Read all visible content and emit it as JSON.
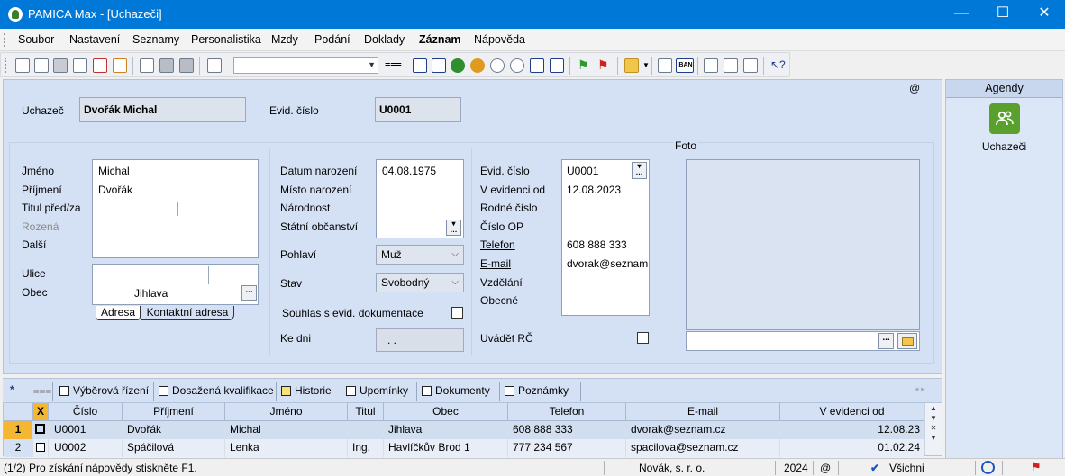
{
  "window": {
    "title": "PAMICA Max - [Uchazeči]",
    "controls": {
      "minimize": "—",
      "maximize": "☐",
      "close": "✕"
    }
  },
  "menu": [
    "Soubor",
    "Nastavení",
    "Seznamy",
    "Personalistika",
    "Mzdy",
    "Podání",
    "Doklady",
    "Záznam",
    "Nápověda"
  ],
  "toolbar": {
    "combo_value": ""
  },
  "header": {
    "at_symbol": "@",
    "uchazec_label": "Uchazeč",
    "uchazec_value": "Dvořák Michal",
    "evid_label": "Evid. číslo",
    "evid_value": "U0001"
  },
  "personal": {
    "jmeno_label": "Jméno",
    "prijmeni_label": "Příjmení",
    "titul_label": "Titul před/za",
    "rozena_label": "Rozená",
    "dalsi_label": "Další",
    "jmeno_value": "Michal",
    "prijmeni_value": "Dvořák"
  },
  "address": {
    "ulice_label": "Ulice",
    "obec_label": "Obec",
    "obec_value": "Jihlava",
    "tab_adresa": "Adresa",
    "tab_kontaktni": "Kontaktní adresa"
  },
  "middle": {
    "datum_label": "Datum narození",
    "misto_label": "Místo narození",
    "narodnost_label": "Národnost",
    "obcanstvi_label": "Státní občanství",
    "datum_value": "04.08.1975",
    "pohlavi_label": "Pohlaví",
    "pohlavi_value": "Muž",
    "stav_label": "Stav",
    "stav_value": "Svobodný",
    "souhlas_label": "Souhlas s evid. dokumentace",
    "kedni_label": "Ke dni",
    "kedni_value": ". ."
  },
  "right": {
    "evid_label": "Evid. číslo",
    "vevidenci_label": "V evidenci od",
    "rodne_label": "Rodné číslo",
    "cislo_op_label": "Číslo OP",
    "telefon_label": "Telefon",
    "email_label": "E-mail",
    "vzdelani_label": "Vzdělání",
    "obecne_label": "Obecné",
    "evid_value": "U0001",
    "vevidenci_value": "12.08.2023",
    "telefon_value": "608 888 333",
    "email_value": "dvorak@seznam",
    "uvadet_label": "Uvádět RČ"
  },
  "foto": {
    "label": "Foto"
  },
  "agendy": {
    "header": "Agendy",
    "item_label": "Uchazeči"
  },
  "tabs": [
    "Výběrová řízení",
    "Dosažená kvalifikace",
    "Historie",
    "Upomínky",
    "Dokumenty",
    "Poznámky"
  ],
  "tabs_star": "*",
  "grid": {
    "columns": [
      "X",
      "Číslo",
      "Příjmení",
      "Jméno",
      "Titul",
      "Obec",
      "Telefon",
      "E-mail",
      "V evidenci od"
    ],
    "rows": [
      {
        "n": "1",
        "cislo": "U0001",
        "prijmeni": "Dvořák",
        "jmeno": "Michal",
        "titul": "",
        "obec": "Jihlava",
        "telefon": "608 888 333",
        "email": "dvorak@seznam.cz",
        "od": "12.08.23"
      },
      {
        "n": "2",
        "cislo": "U0002",
        "prijmeni": "Spáčilová",
        "jmeno": "Lenka",
        "titul": "Ing.",
        "obec": "Havlíčkův Brod 1",
        "telefon": "777 234 567",
        "email": "spacilova@seznam.cz",
        "od": "01.02.24"
      }
    ]
  },
  "status": {
    "help": "(1/2) Pro získání nápovědy stiskněte F1.",
    "company": "Novák, s. r. o.",
    "year": "2024",
    "at": "@",
    "filter": "Všichni"
  },
  "colors": {
    "titlebar": "#0078d7",
    "form_bg": "#d4e1f5",
    "row_marker": "#f5b731",
    "agendy_icon": "#5aa02c"
  }
}
